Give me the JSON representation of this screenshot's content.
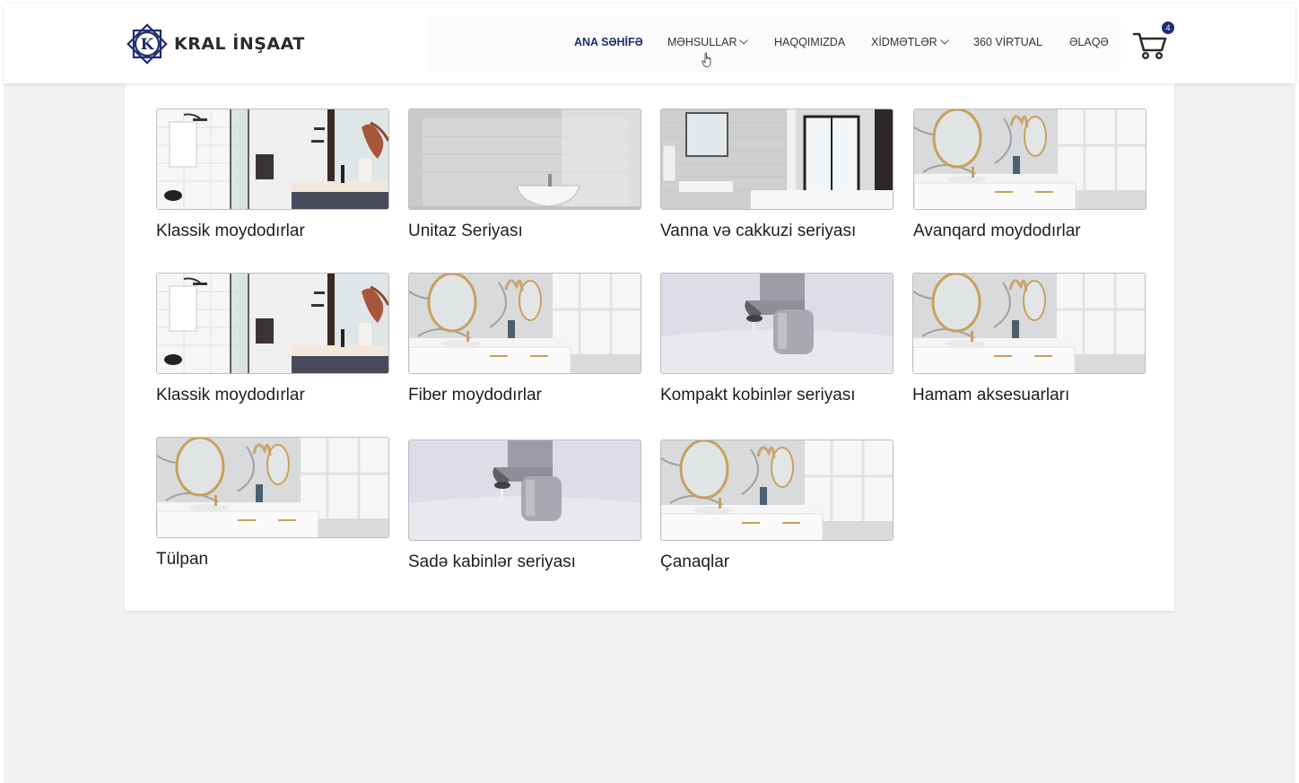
{
  "brand": {
    "name": "KRAL İNŞAAT",
    "logo_letter": "K"
  },
  "nav": {
    "items": [
      {
        "label": "ANA SƏHİFƏ",
        "active": true,
        "dropdown": false
      },
      {
        "label": "MƏHSULLAR",
        "active": false,
        "dropdown": true
      },
      {
        "label": "HAQQIMIZDA",
        "active": false,
        "dropdown": false
      },
      {
        "label": "XİDMƏTLƏR",
        "active": false,
        "dropdown": true
      },
      {
        "label": "360 VİRTUAL",
        "active": false,
        "dropdown": false
      },
      {
        "label": "ƏLAQƏ",
        "active": false,
        "dropdown": false
      }
    ]
  },
  "cart": {
    "count": "4",
    "icon": "cart-icon"
  },
  "products": [
    {
      "name": "Klassik moydodırlar",
      "image": "shower-bathroom"
    },
    {
      "name": "Unitaz Seriyası",
      "image": "wall-sink"
    },
    {
      "name": "Vanna və cakkuzi seriyası",
      "image": "bath-window"
    },
    {
      "name": "Avanqard moydodırlar",
      "image": "marble-vanity"
    },
    {
      "name": "Klassik moydodırlar",
      "image": "shower-bathroom"
    },
    {
      "name": "Fiber moydodırlar",
      "image": "marble-vanity"
    },
    {
      "name": "Kompakt kobinlər seriyası",
      "image": "faucet"
    },
    {
      "name": "Hamam aksesuarları",
      "image": "marble-vanity"
    },
    {
      "name": "Tülpan",
      "image": "marble-vanity"
    },
    {
      "name": "Sadə kabinlər seriyası",
      "image": "faucet"
    },
    {
      "name": "Çanaqlar",
      "image": "marble-vanity"
    }
  ],
  "colors": {
    "accent": "#1f2d73",
    "page_bg": "#f2f2f2",
    "text": "#1e1e1e"
  }
}
